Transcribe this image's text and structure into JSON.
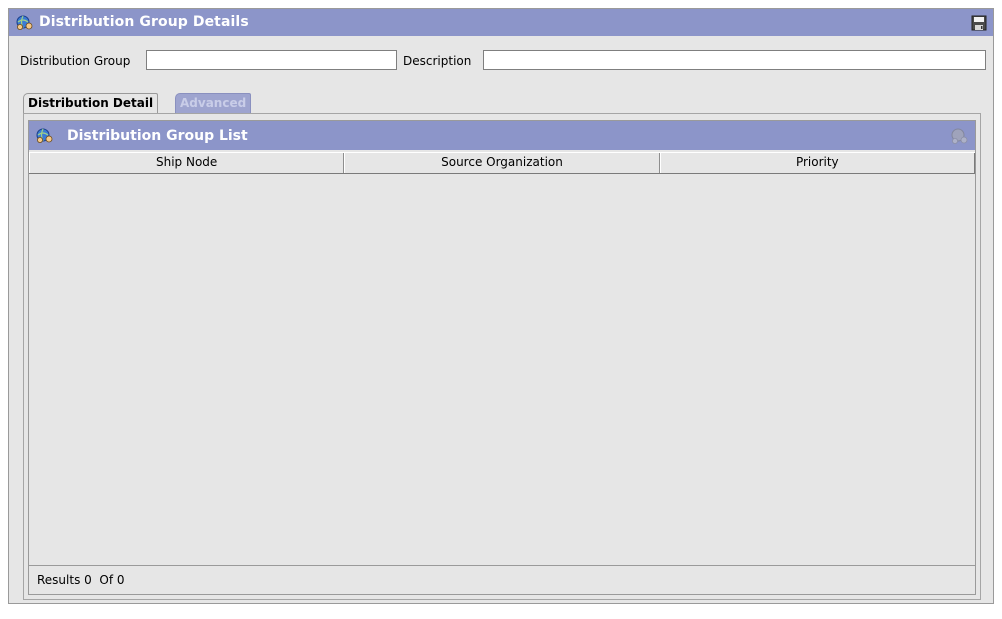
{
  "window": {
    "title": "Distribution Group Details",
    "title_icon": "globe-people-icon",
    "save_icon": "save-icon"
  },
  "form": {
    "distribution_group_label": "Distribution Group",
    "distribution_group_value": "",
    "description_label": "Description",
    "description_value": ""
  },
  "tabs": [
    {
      "label": "Distribution Detail",
      "active": true
    },
    {
      "label": "Advanced",
      "active": false
    }
  ],
  "list": {
    "title": "Distribution Group List",
    "title_icon": "globe-people-icon",
    "action_icon": "globe-people-disabled-icon",
    "columns": [
      "Ship Node",
      "Source Organization",
      "Priority"
    ],
    "rows": [],
    "results_text": "Results 0  Of 0"
  },
  "colors": {
    "title_bar": "#8c95c9",
    "background": "#e6e6e6"
  }
}
